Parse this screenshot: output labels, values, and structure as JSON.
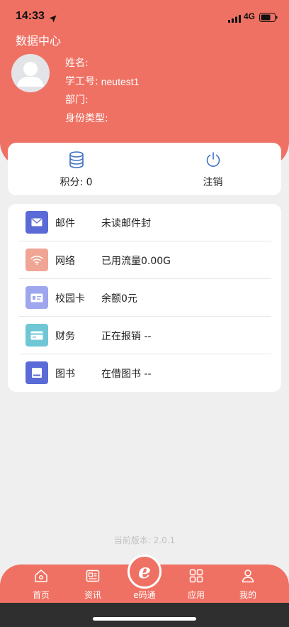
{
  "status": {
    "time": "14:33",
    "network": "4G"
  },
  "header": {
    "title": "数据中心",
    "profile": [
      {
        "label": "姓名:",
        "value": ""
      },
      {
        "label": "学工号:",
        "value": "neutest1"
      },
      {
        "label": "部门:",
        "value": ""
      },
      {
        "label": "身份类型:",
        "value": ""
      }
    ]
  },
  "quick": {
    "points_label": "积分: 0",
    "logout_label": "注销"
  },
  "services": [
    {
      "name": "邮件",
      "value": "未读邮件封",
      "icon": "mail-icon",
      "color": "#5a6ad6"
    },
    {
      "name": "网络",
      "value": "已用流量0.00G",
      "icon": "wifi-icon",
      "color": "#f0a594"
    },
    {
      "name": "校园卡",
      "value": "余额0元",
      "icon": "id-card-icon",
      "color": "#9ea6ee"
    },
    {
      "name": "财务",
      "value": "正在报销 --",
      "icon": "wallet-icon",
      "color": "#6fc7d5"
    },
    {
      "name": "图书",
      "value": "在借图书 --",
      "icon": "book-icon",
      "color": "#5a6ad6"
    }
  ],
  "version": "当前版本: 2.0.1",
  "tabs": [
    {
      "label": "首页",
      "icon": "home-icon"
    },
    {
      "label": "资讯",
      "icon": "news-icon"
    },
    {
      "label": "e码通",
      "icon": "e-code-icon"
    },
    {
      "label": "应用",
      "icon": "apps-icon"
    },
    {
      "label": "我的",
      "icon": "user-icon"
    }
  ],
  "colors": {
    "accent": "#ef7163",
    "background": "#efefef"
  }
}
